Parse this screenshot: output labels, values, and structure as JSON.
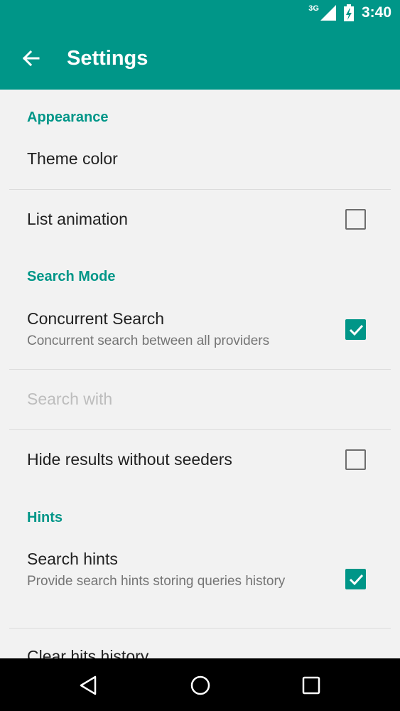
{
  "status_bar": {
    "network": "3G",
    "time": "3:40"
  },
  "toolbar": {
    "title": "Settings"
  },
  "sections": [
    {
      "category": "Appearance",
      "items": [
        {
          "title": "Theme color"
        },
        {
          "title": "List animation",
          "checked": false
        }
      ]
    },
    {
      "category": "Search Mode",
      "items": [
        {
          "title": "Concurrent Search",
          "summary": "Concurrent search between all providers",
          "checked": true
        },
        {
          "title": "Search with",
          "disabled": true
        },
        {
          "title": "Hide results without seeders",
          "checked": false
        }
      ]
    },
    {
      "category": "Hints",
      "items": [
        {
          "title": "Search hints",
          "summary": "Provide search hints storing queries history",
          "checked": true
        },
        {
          "title": "Clear hits history"
        }
      ]
    }
  ],
  "colors": {
    "accent": "#009688",
    "background": "#f2f2f2"
  },
  "icons": [
    "signal-icon",
    "battery-icon",
    "back-arrow-icon",
    "checkbox-check-icon",
    "nav-back-icon",
    "nav-home-icon",
    "nav-recents-icon"
  ]
}
